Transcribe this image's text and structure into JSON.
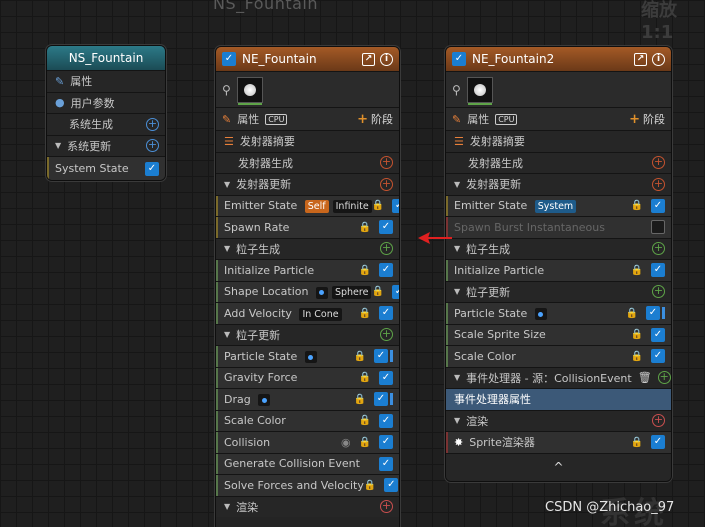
{
  "graph": {
    "title": "NS_Fountain",
    "zoom": "缩放1:1"
  },
  "watermark": {
    "text": "CSDN @Zhichao_97",
    "ghost": "系统"
  },
  "system_node": {
    "title": "NS_Fountain",
    "rows": {
      "properties": "属性",
      "user_params": "用户参数",
      "sys_spawn": "系统生成",
      "sys_update": "系统更新",
      "system_state": "System State"
    }
  },
  "emitter1": {
    "title": "NE_Fountain",
    "properties": "属性",
    "cpu": "CPU",
    "stage": "阶段",
    "summary": "发射器摘要",
    "emitter_spawn": "发射器生成",
    "emitter_update": "发射器更新",
    "emitter_state": {
      "label": "Emitter State",
      "tag1": "Self",
      "tag2": "Infinite"
    },
    "spawn_rate": "Spawn Rate",
    "particle_spawn": "粒子生成",
    "init_particle": "Initialize Particle",
    "shape_location": {
      "label": "Shape Location",
      "tag": "Sphere"
    },
    "add_velocity": {
      "label": "Add Velocity",
      "tag": "In Cone"
    },
    "particle_update": "粒子更新",
    "particle_state": "Particle State",
    "gravity_force": "Gravity Force",
    "drag": "Drag",
    "scale_color": "Scale Color",
    "collision": "Collision",
    "gen_collision_event": "Generate Collision Event",
    "solve_forces": "Solve Forces and Velocity",
    "render": "渲染"
  },
  "emitter2": {
    "title": "NE_Fountain2",
    "properties": "属性",
    "cpu": "CPU",
    "stage": "阶段",
    "summary": "发射器摘要",
    "emitter_spawn": "发射器生成",
    "emitter_update": "发射器更新",
    "emitter_state": {
      "label": "Emitter State",
      "tag": "System"
    },
    "spawn_burst": "Spawn Burst Instantaneous",
    "particle_spawn": "粒子生成",
    "init_particle": "Initialize Particle",
    "particle_update": "粒子更新",
    "particle_state": "Particle State",
    "scale_sprite_size": "Scale Sprite Size",
    "scale_color": "Scale Color",
    "event_handler": "事件处理器 - 源：CollisionEvent",
    "event_handler_props": "事件处理器属性",
    "render": "渲染",
    "sprite_renderer": "Sprite渲染器",
    "collapse": "^"
  }
}
